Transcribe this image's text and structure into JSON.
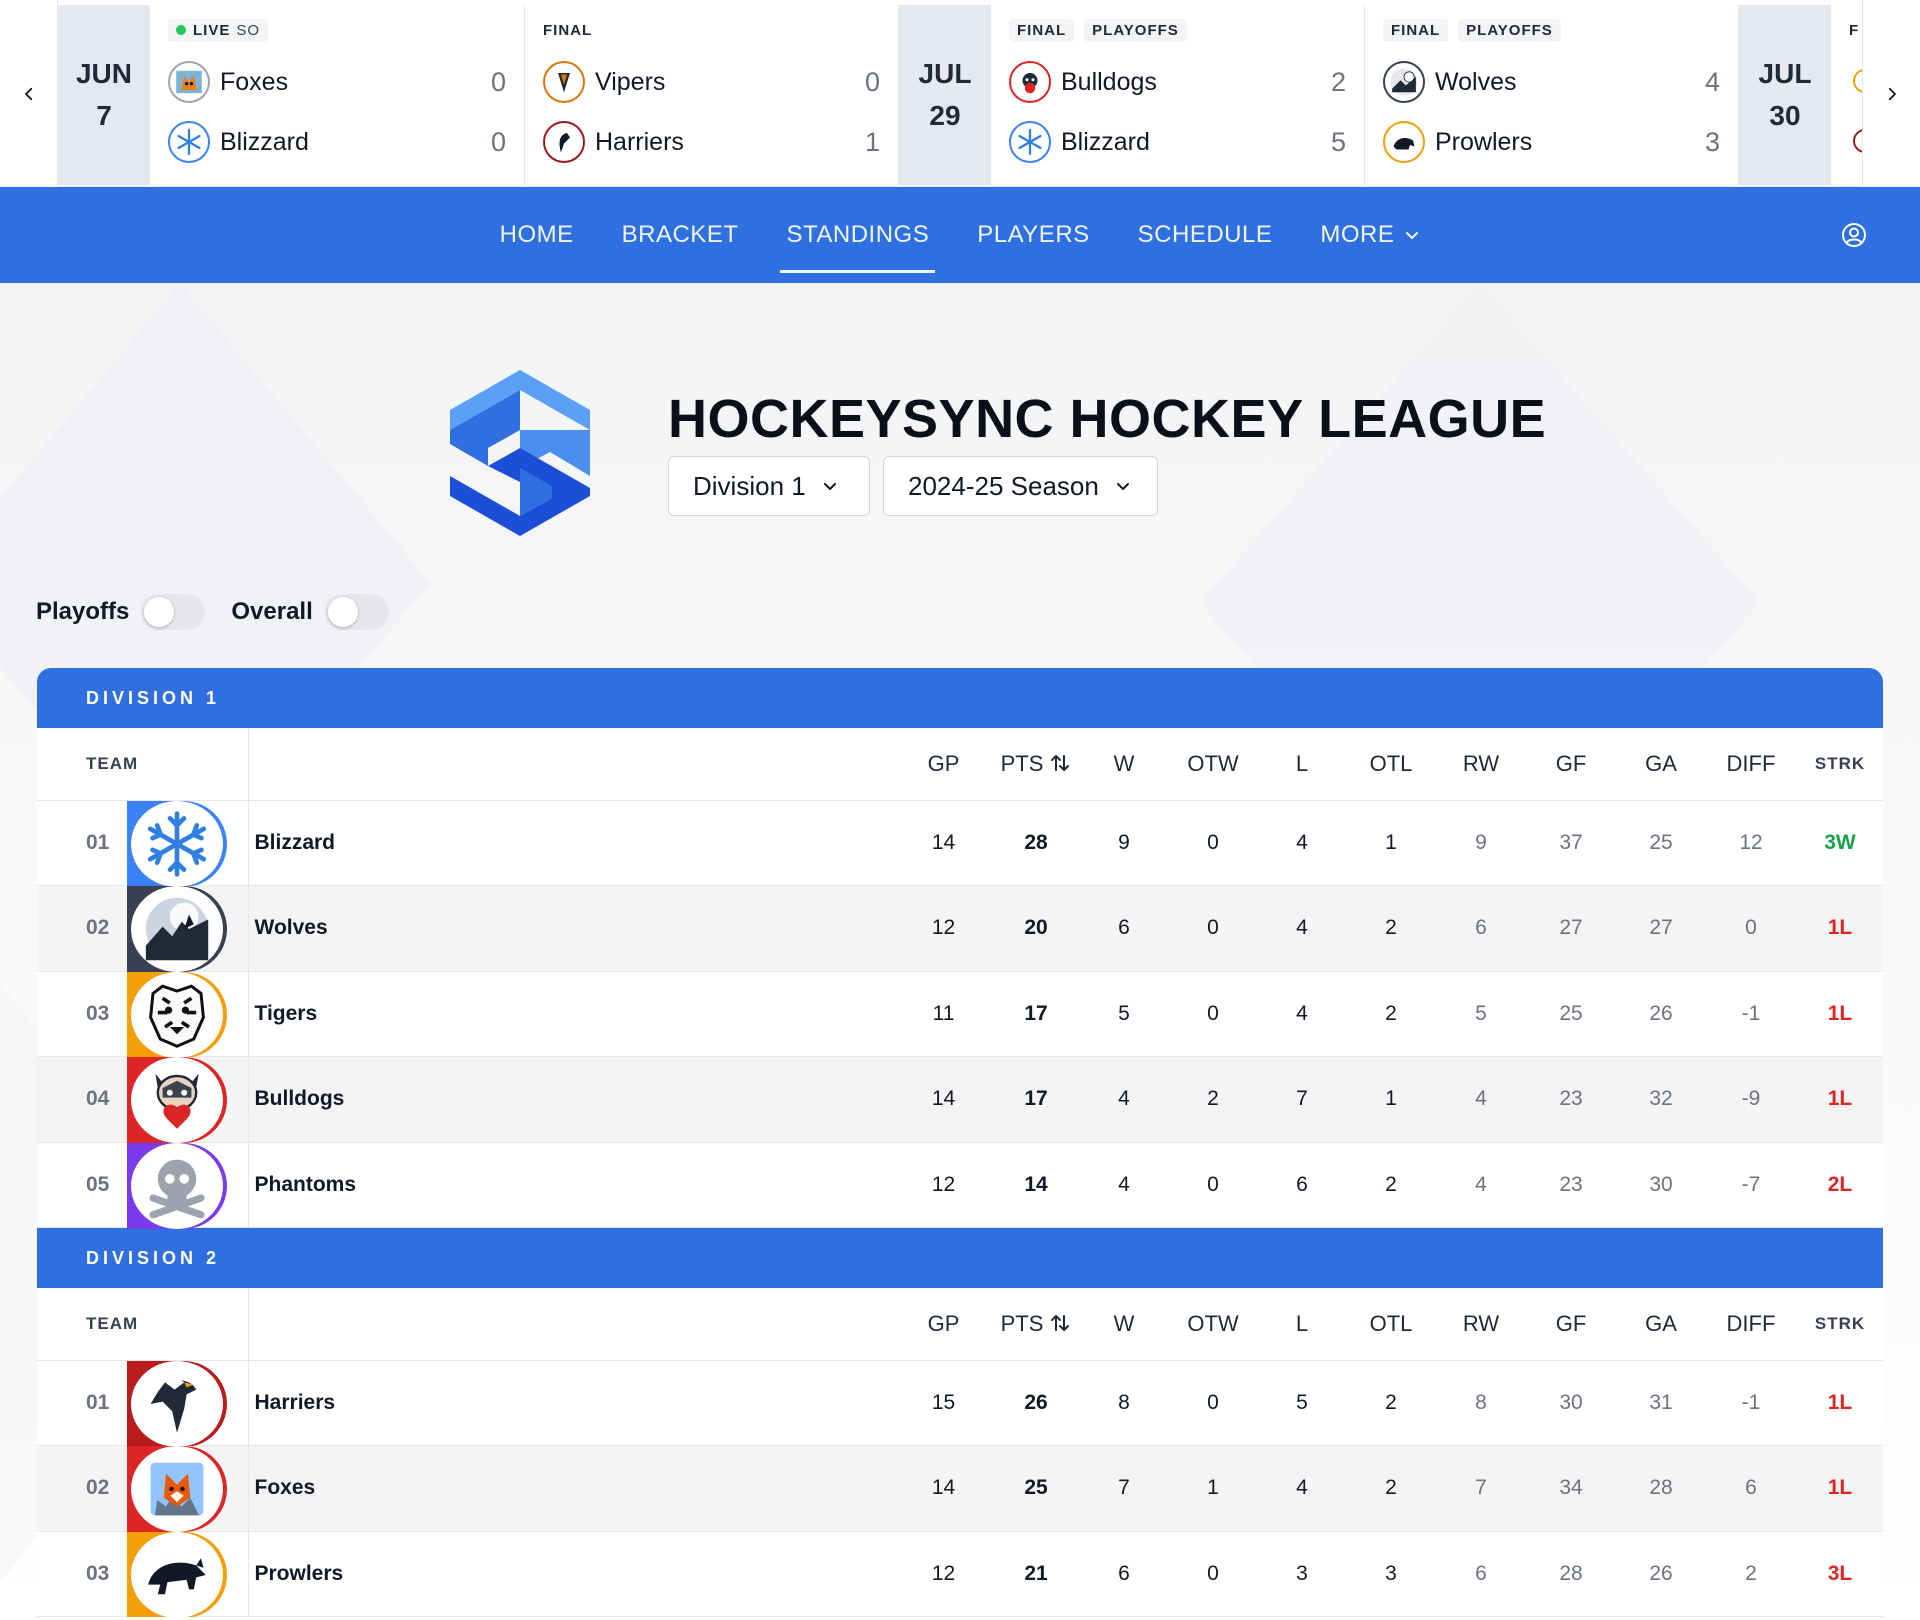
{
  "ticker": {
    "games": [
      {
        "date_month": "JUN",
        "date_day": "7",
        "tags": [
          "LIVE"
        ],
        "live_sub": "SO",
        "home": {
          "name": "Foxes",
          "score": "0",
          "icon": "fox-icon",
          "ring": "#9ca3af"
        },
        "away": {
          "name": "Blizzard",
          "score": "0",
          "icon": "snowflake-icon",
          "ring": "#3b82f6"
        }
      },
      {
        "tags": [
          "FINAL"
        ],
        "home": {
          "name": "Vipers",
          "score": "0",
          "icon": "viper-icon",
          "ring": "#d97706"
        },
        "away": {
          "name": "Harriers",
          "score": "1",
          "icon": "harrier-icon",
          "ring": "#991b1b"
        }
      },
      {
        "date_month": "JUL",
        "date_day": "29",
        "tags": [
          "FINAL",
          "PLAYOFFS"
        ],
        "home": {
          "name": "Bulldogs",
          "score": "2",
          "icon": "bulldog-icon",
          "ring": "#dc2626"
        },
        "away": {
          "name": "Blizzard",
          "score": "5",
          "icon": "snowflake-icon",
          "ring": "#3b82f6"
        }
      },
      {
        "tags": [
          "FINAL",
          "PLAYOFFS"
        ],
        "home": {
          "name": "Wolves",
          "score": "4",
          "icon": "wolf-icon",
          "ring": "#374151"
        },
        "away": {
          "name": "Prowlers",
          "score": "3",
          "icon": "panther-icon",
          "ring": "#f59e0b"
        }
      },
      {
        "date_month": "JUL",
        "date_day": "30",
        "tags": [
          "F"
        ]
      }
    ]
  },
  "nav": {
    "items": [
      "HOME",
      "BRACKET",
      "STANDINGS",
      "PLAYERS",
      "SCHEDULE",
      "MORE"
    ],
    "active": "STANDINGS"
  },
  "header": {
    "title": "HOCKEYSYNC HOCKEY LEAGUE",
    "division_select": "Division 1",
    "season_select": "2024-25 Season"
  },
  "toggles": {
    "playoffs_label": "Playoffs",
    "overall_label": "Overall"
  },
  "columns": [
    "GP",
    "PTS",
    "W",
    "OTW",
    "L",
    "OTL",
    "RW",
    "GF",
    "GA",
    "DIFF",
    "STRK"
  ],
  "team_header": "TEAM",
  "divisions": [
    {
      "name": "DIVISION 1",
      "rows": [
        {
          "rank": "01",
          "team": "Blizzard",
          "icon": "snowflake-icon",
          "ring": "#3b82f6",
          "gp": "14",
          "pts": "28",
          "w": "9",
          "otw": "0",
          "l": "4",
          "otl": "1",
          "rw": "9",
          "gf": "37",
          "ga": "25",
          "diff": "12",
          "strk": "3W"
        },
        {
          "rank": "02",
          "team": "Wolves",
          "icon": "wolf-icon",
          "ring": "#374151",
          "gp": "12",
          "pts": "20",
          "w": "6",
          "otw": "0",
          "l": "4",
          "otl": "2",
          "rw": "6",
          "gf": "27",
          "ga": "27",
          "diff": "0",
          "strk": "1L"
        },
        {
          "rank": "03",
          "team": "Tigers",
          "icon": "tiger-icon",
          "ring": "#f59e0b",
          "gp": "11",
          "pts": "17",
          "w": "5",
          "otw": "0",
          "l": "4",
          "otl": "2",
          "rw": "5",
          "gf": "25",
          "ga": "26",
          "diff": "-1",
          "strk": "1L"
        },
        {
          "rank": "04",
          "team": "Bulldogs",
          "icon": "bulldog-icon",
          "ring": "#dc2626",
          "gp": "14",
          "pts": "17",
          "w": "4",
          "otw": "2",
          "l": "7",
          "otl": "1",
          "rw": "4",
          "gf": "23",
          "ga": "32",
          "diff": "-9",
          "strk": "1L"
        },
        {
          "rank": "05",
          "team": "Phantoms",
          "icon": "skull-icon",
          "ring": "#7c3aed",
          "gp": "12",
          "pts": "14",
          "w": "4",
          "otw": "0",
          "l": "6",
          "otl": "2",
          "rw": "4",
          "gf": "23",
          "ga": "30",
          "diff": "-7",
          "strk": "2L"
        }
      ]
    },
    {
      "name": "DIVISION 2",
      "rows": [
        {
          "rank": "01",
          "team": "Harriers",
          "icon": "harrier-icon",
          "ring": "#b91c1c",
          "gp": "15",
          "pts": "26",
          "w": "8",
          "otw": "0",
          "l": "5",
          "otl": "2",
          "rw": "8",
          "gf": "30",
          "ga": "31",
          "diff": "-1",
          "strk": "1L"
        },
        {
          "rank": "02",
          "team": "Foxes",
          "icon": "fox-icon",
          "ring": "#dc2626",
          "gp": "14",
          "pts": "25",
          "w": "7",
          "otw": "1",
          "l": "4",
          "otl": "2",
          "rw": "7",
          "gf": "34",
          "ga": "28",
          "diff": "6",
          "strk": "1L"
        },
        {
          "rank": "03",
          "team": "Prowlers",
          "icon": "panther-icon",
          "ring": "#f59e0b",
          "gp": "12",
          "pts": "21",
          "w": "6",
          "otw": "0",
          "l": "3",
          "otl": "3",
          "rw": "6",
          "gf": "28",
          "ga": "26",
          "diff": "2",
          "strk": "3L"
        }
      ]
    }
  ]
}
